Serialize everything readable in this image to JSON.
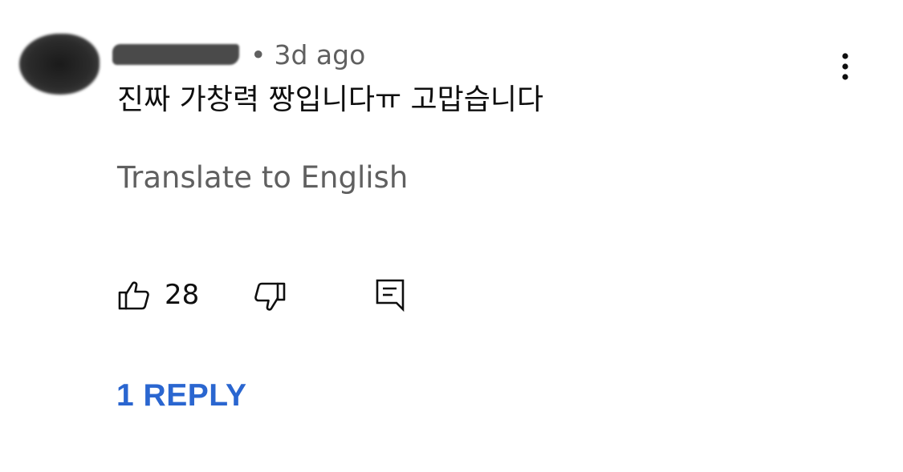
{
  "comment": {
    "time_ago": "3d ago",
    "separator": "•",
    "text": "진짜 가창력 짱입니다ㅠ 고맙습니다",
    "translate_label": "Translate to English",
    "like_count": "28",
    "replies_label": "1 REPLY"
  },
  "icons": {
    "more": "more-vertical-icon",
    "like": "thumbs-up-icon",
    "dislike": "thumbs-down-icon",
    "reply": "comment-reply-icon"
  },
  "colors": {
    "link_blue": "#2a66d0",
    "secondary_text": "#606060",
    "primary_text": "#0f0f0f"
  }
}
